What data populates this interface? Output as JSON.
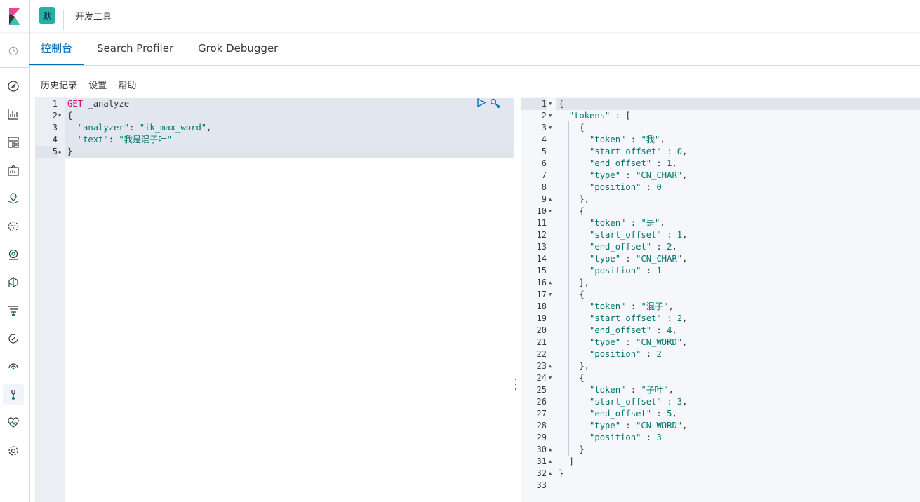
{
  "header": {
    "space_initial": "默",
    "breadcrumb": "开发工具"
  },
  "tabs": [
    {
      "label": "控制台",
      "selected": true
    },
    {
      "label": "Search Profiler",
      "selected": false
    },
    {
      "label": "Grok Debugger",
      "selected": false
    }
  ],
  "toolbar": {
    "history": "历史记录",
    "settings": "设置",
    "help": "帮助"
  },
  "nav_icons": [
    "clock-icon",
    "compass-icon",
    "visualize-icon",
    "dashboard-icon",
    "canvas-icon",
    "maps-icon",
    "ml-icon",
    "infra-icon",
    "apm-icon",
    "uptime-icon",
    "siem-icon",
    "monitoring-icon",
    "devtools-icon",
    "stack-monitoring-icon",
    "management-icon"
  ],
  "request_lines": [
    "GET _analyze",
    "{",
    "  \"analyzer\": \"ik_max_word\",",
    "  \"text\": \"我是混子叶\"",
    "}"
  ],
  "response_lines": [
    "{",
    "  \"tokens\" : [",
    "    {",
    "      \"token\" : \"我\",",
    "      \"start_offset\" : 0,",
    "      \"end_offset\" : 1,",
    "      \"type\" : \"CN_CHAR\",",
    "      \"position\" : 0",
    "    },",
    "    {",
    "      \"token\" : \"是\",",
    "      \"start_offset\" : 1,",
    "      \"end_offset\" : 2,",
    "      \"type\" : \"CN_CHAR\",",
    "      \"position\" : 1",
    "    },",
    "    {",
    "      \"token\" : \"混子\",",
    "      \"start_offset\" : 2,",
    "      \"end_offset\" : 4,",
    "      \"type\" : \"CN_WORD\",",
    "      \"position\" : 2",
    "    },",
    "    {",
    "      \"token\" : \"子叶\",",
    "      \"start_offset\" : 3,",
    "      \"end_offset\" : 5,",
    "      \"type\" : \"CN_WORD\",",
    "      \"position\" : 3",
    "    }",
    "  ]",
    "}",
    ""
  ],
  "request_folds": {
    "2": "down",
    "5": "up"
  },
  "response_folds": {
    "1": "down",
    "2": "down",
    "3": "down",
    "9": "up",
    "10": "down",
    "16": "up",
    "17": "down",
    "23": "up",
    "24": "down",
    "30": "up",
    "31": "up",
    "32": "up"
  }
}
